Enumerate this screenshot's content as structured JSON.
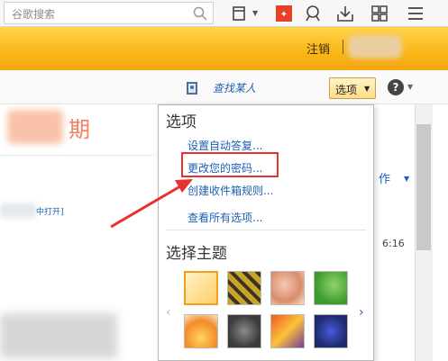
{
  "browser": {
    "search_placeholder": "谷歌搜索",
    "icons": [
      "search-icon",
      "layout-icon",
      "app-icon",
      "fox-icon",
      "download-icon",
      "grid-icon",
      "menu-icon"
    ]
  },
  "mail_header": {
    "logout_label": "注销"
  },
  "toolbar": {
    "find_person_label": "查找某人",
    "options_label": "选项",
    "help_label": "?"
  },
  "content": {
    "date_visible_char": "期",
    "open_in_window_link": "中打开]",
    "right_action_label": "作",
    "right_time_label": "6:16"
  },
  "options_menu": {
    "title": "选项",
    "items": [
      {
        "label": "设置自动答复..."
      },
      {
        "label": "更改您的密码..."
      },
      {
        "label": "创建收件箱规则..."
      },
      {
        "label": "查看所有选项..."
      }
    ],
    "theme_title": "选择主题",
    "themes": [
      "theme-plain-orange",
      "theme-yellow-pattern",
      "theme-cartoon-pink",
      "theme-green-leaf",
      "theme-orange-sun",
      "theme-robot",
      "theme-colorful",
      "theme-blue-creature"
    ]
  },
  "colors": {
    "header_orange": "#f9b81a",
    "link_blue": "#1b5fb5",
    "highlight_red": "#e8312e"
  }
}
